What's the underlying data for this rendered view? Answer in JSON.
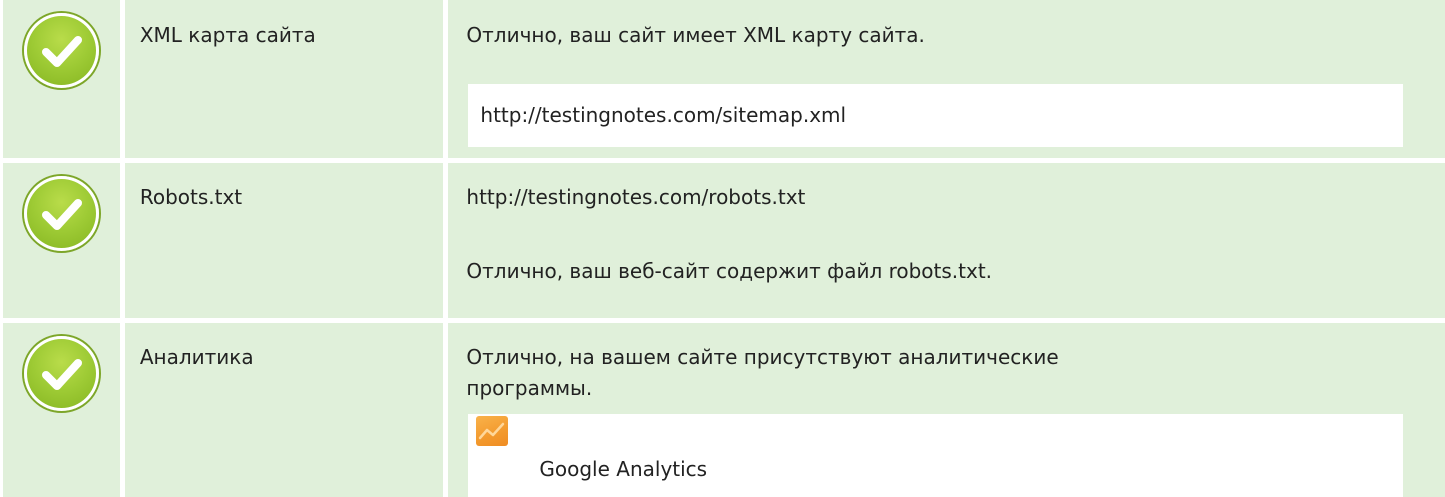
{
  "rows": [
    {
      "name": "XML карта сайта",
      "status_icon": "check-circle-icon",
      "message": "Отлично, ваш сайт имеет XML карту сайта.",
      "detail": "http://testingnotes.com/sitemap.xml"
    },
    {
      "name": "Robots.txt",
      "status_icon": "check-circle-icon",
      "detail": "http://testingnotes.com/robots.txt",
      "message": "Отлично, ваш веб-сайт содержит файл robots.txt."
    },
    {
      "name": "Аналитика",
      "status_icon": "check-circle-icon",
      "message_line1": "Отлично, на вашем сайте присутствуют аналитические",
      "message_line2": "программы.",
      "tool": {
        "icon": "google-analytics-icon",
        "label": "Google Analytics"
      }
    }
  ],
  "colors": {
    "row_bg": "#e0f0da",
    "status_ok": "#9ecb35",
    "box_bg": "#ffffff"
  }
}
